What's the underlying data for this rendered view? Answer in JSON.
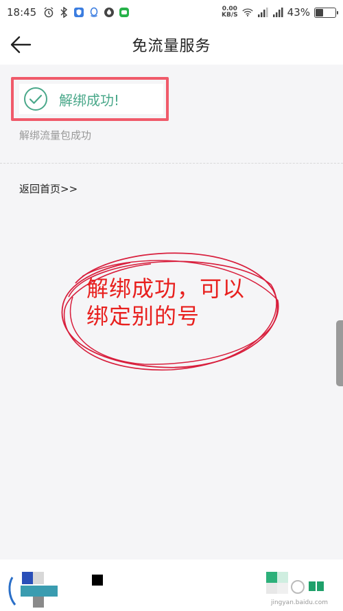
{
  "status_bar": {
    "time": "18:45",
    "net_speed_value": "0.00",
    "net_speed_unit": "KB/S",
    "battery_percent": "43%",
    "battery_level": 0.43
  },
  "header": {
    "title": "免流量服务",
    "back_icon": "arrow-left-icon"
  },
  "result": {
    "status_title": "解绑成功!",
    "status_detail": "解绑流量包成功",
    "accent_color": "#4aa88a",
    "highlight_color": "#f05a6a"
  },
  "actions": {
    "home_link": "返回首页>>"
  },
  "annotation": {
    "text": "解绑成功，可以绑定别的号",
    "color": "#e8201e"
  },
  "footer": {
    "watermark": "jingyan.baidu.com"
  }
}
